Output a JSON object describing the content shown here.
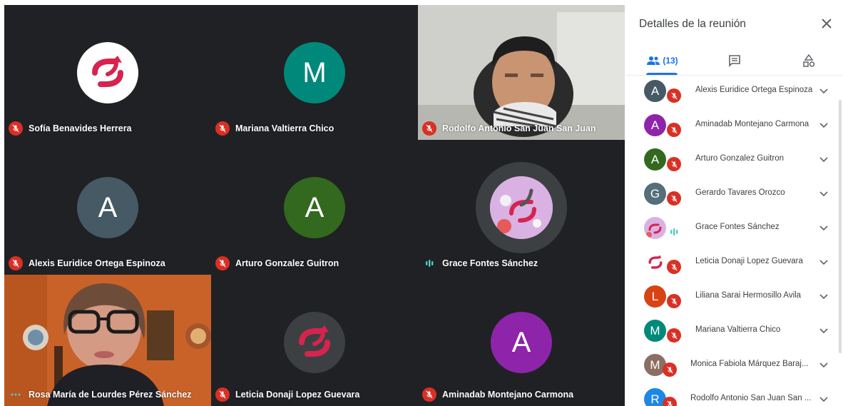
{
  "tiles": [
    {
      "name": "Sofía Benavides Herrera",
      "avatar_type": "logo",
      "mic": "muted"
    },
    {
      "name": "Mariana Valtierra Chico",
      "avatar_letter": "M",
      "avatar_color": "#00897b",
      "mic": "muted"
    },
    {
      "name": "Rodolfo Antonio San Juan San Juan",
      "avatar_type": "camera",
      "mic": "muted"
    },
    {
      "name": "Alexis Euridice Ortega Espinoza",
      "avatar_letter": "A",
      "avatar_color": "#455a64",
      "mic": "muted"
    },
    {
      "name": "Arturo Gonzalez Guitron",
      "avatar_letter": "A",
      "avatar_color": "#33691e",
      "mic": "muted"
    },
    {
      "name": "Grace Fontes Sánchez",
      "avatar_type": "photo",
      "mic": "speaking"
    },
    {
      "name": "Rosa María de Lourdes Pérez Sánchez",
      "avatar_type": "camera",
      "mic": "dots"
    },
    {
      "name": "Leticia Donaji Lopez Guevara",
      "avatar_type": "logo",
      "mic": "muted"
    },
    {
      "name": "Aminadab Montejano Carmona",
      "avatar_letter": "A",
      "avatar_color": "#8e24aa",
      "mic": "muted"
    }
  ],
  "panel": {
    "title": "Detalles de la reunión",
    "people_count": "(13)",
    "tabs": [
      "people-icon",
      "chat-icon",
      "activities-icon"
    ],
    "participants": [
      {
        "name": "Alexis Euridice Ortega Espinoza",
        "letter": "A",
        "color": "#455a64",
        "mic": "muted"
      },
      {
        "name": "Aminadab Montejano Carmona",
        "letter": "A",
        "color": "#8e24aa",
        "mic": "muted"
      },
      {
        "name": "Arturo Gonzalez Guitron",
        "letter": "A",
        "color": "#33691e",
        "mic": "muted"
      },
      {
        "name": "Gerardo Tavares Orozco",
        "letter": "G",
        "color": "#546e7a",
        "mic": "muted"
      },
      {
        "name": "Grace Fontes Sánchez",
        "letter": "",
        "color": "#ce93d8",
        "mic": "speaking"
      },
      {
        "name": "Leticia Donaji Lopez Guevara",
        "letter": "",
        "color": "#ffffff",
        "mic": "muted"
      },
      {
        "name": "Liliana Sarai Hermosillo Avila",
        "letter": "L",
        "color": "#d84315",
        "mic": "muted"
      },
      {
        "name": "Mariana Valtierra Chico",
        "letter": "M",
        "color": "#00897b",
        "mic": "muted"
      },
      {
        "name": "Monica Fabiola Márquez Baraj...",
        "letter": "M",
        "color": "#8d6e63",
        "mic": "muted"
      },
      {
        "name": "Rodolfo Antonio San Juan San ...",
        "letter": "R",
        "color": "#1e88e5",
        "mic": "muted"
      }
    ]
  }
}
